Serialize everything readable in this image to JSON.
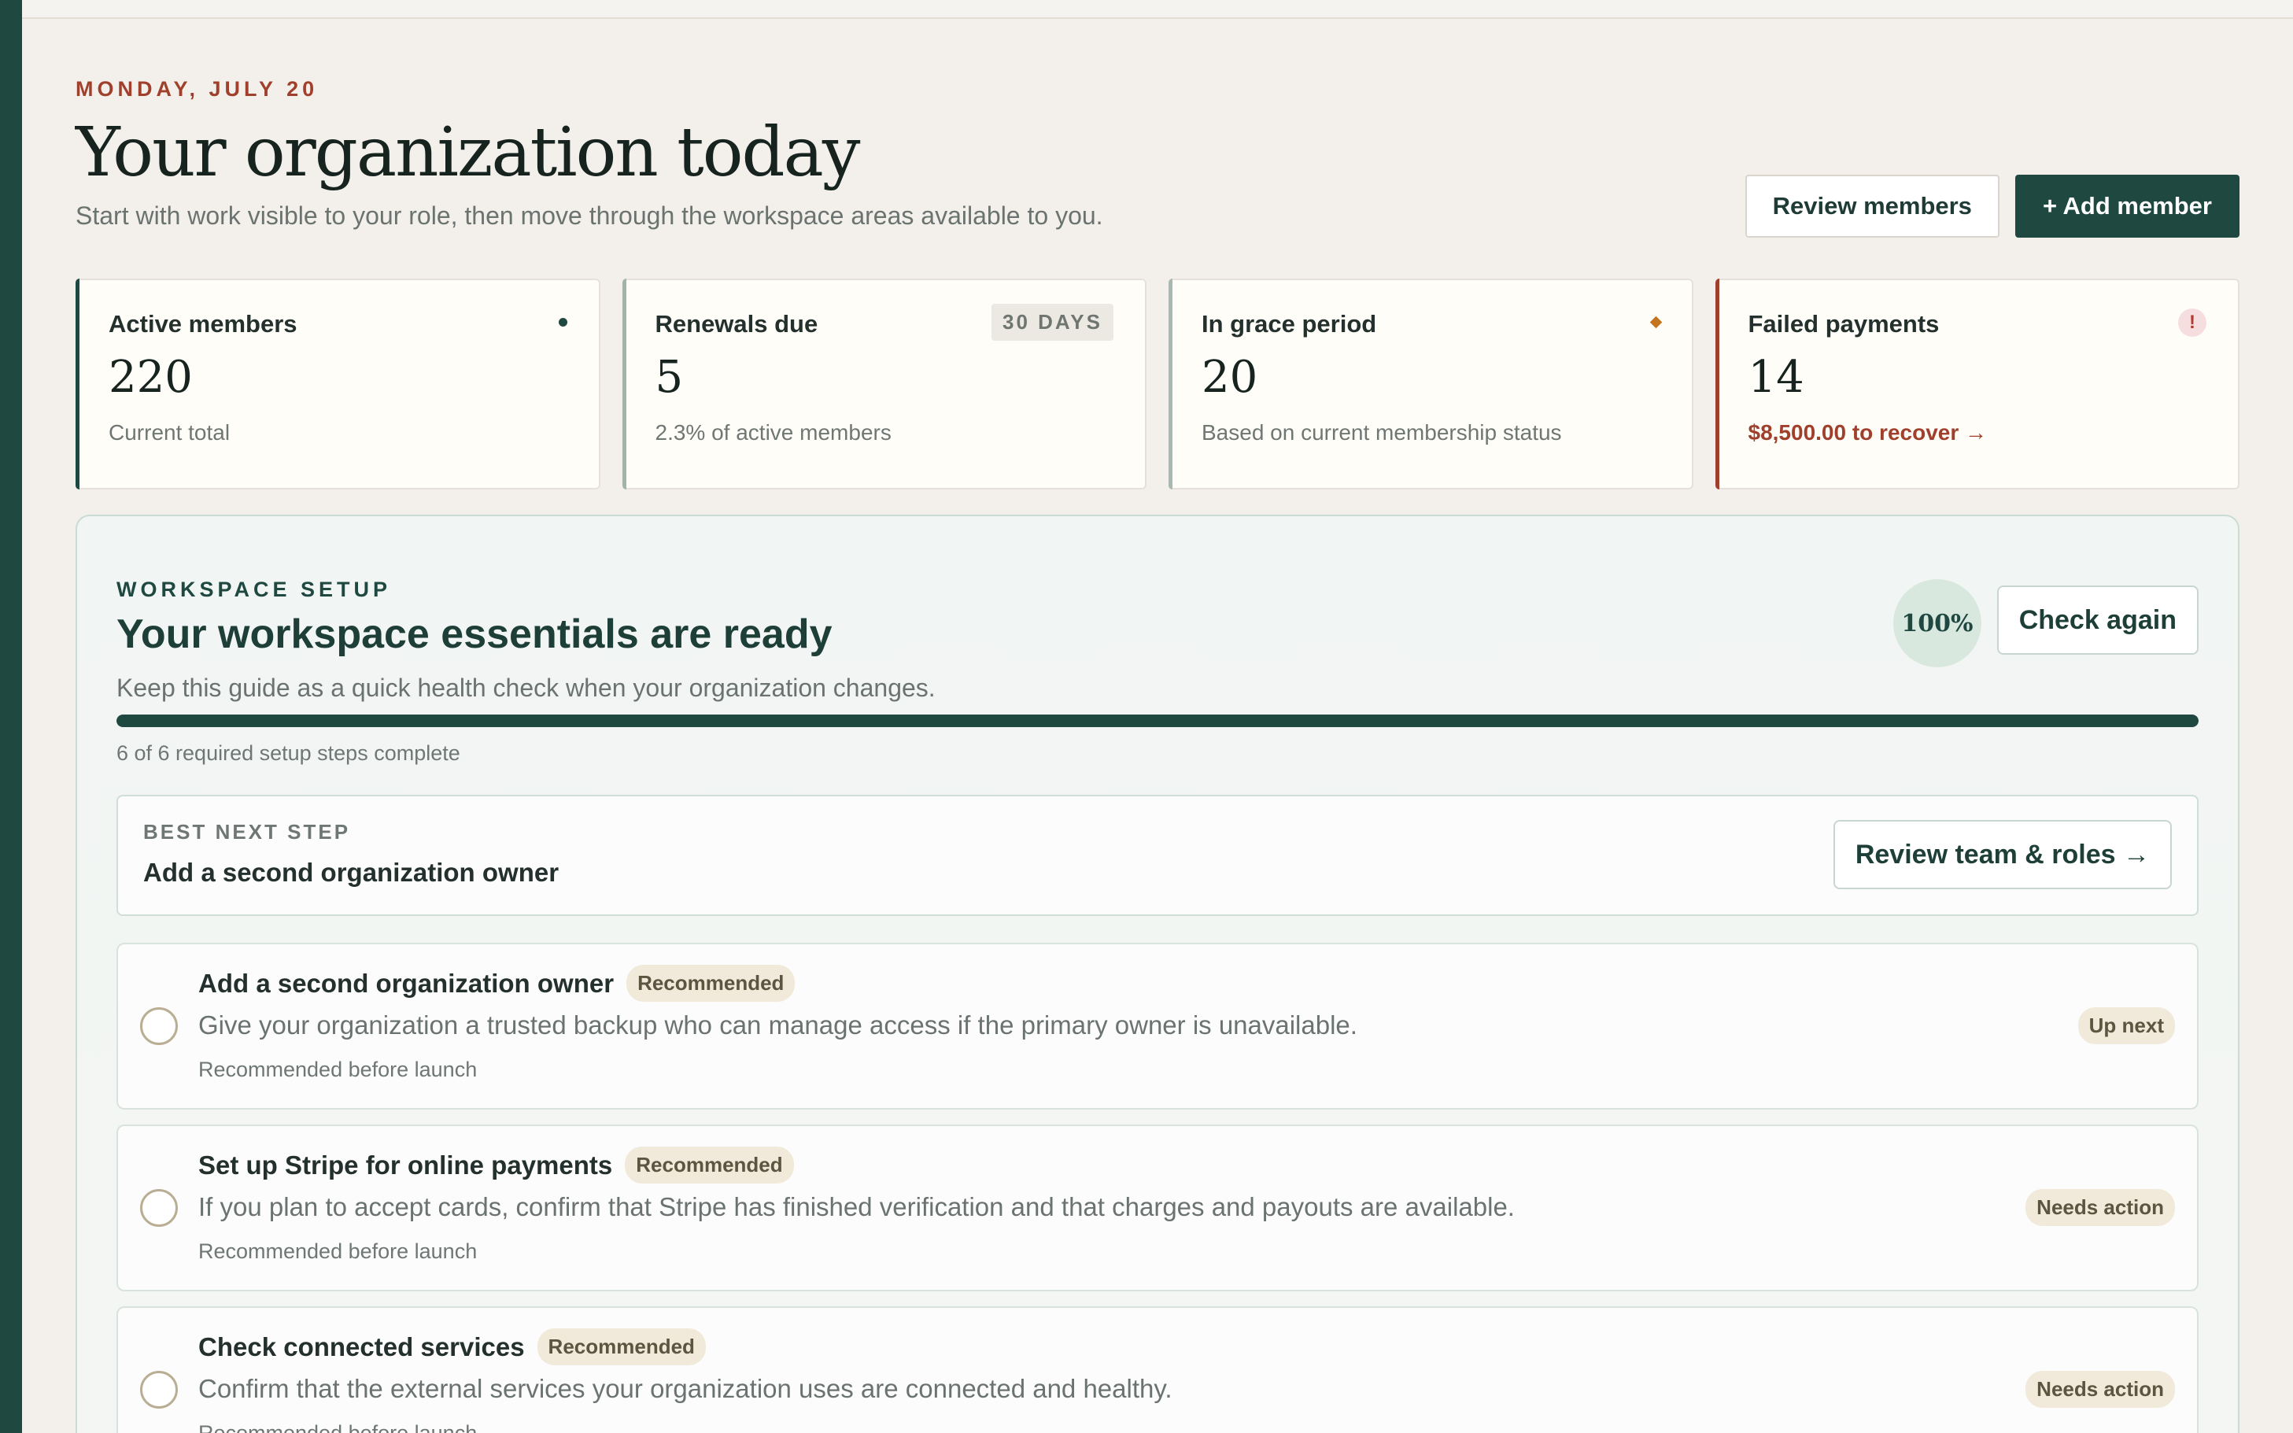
{
  "header": {
    "date": "MONDAY, JULY 20",
    "title": "Your organization today",
    "subtitle": "Start with work visible to your role, then move through the workspace areas available to you.",
    "review_members_label": "Review members",
    "add_member_label": "+  Add member"
  },
  "stats": [
    {
      "label": "Active members",
      "value": "220",
      "note": "Current total",
      "indicator": "dot-icon"
    },
    {
      "label": "Renewals due",
      "value": "5",
      "note": "2.3% of active members",
      "badge": "30 DAYS"
    },
    {
      "label": "In grace period",
      "value": "20",
      "note": "Based on current membership status",
      "indicator": "diamond-icon"
    },
    {
      "label": "Failed payments",
      "value": "14",
      "note": "$8,500.00 to recover →",
      "indicator": "exclamation-icon",
      "indicator_glyph": "!"
    }
  ],
  "setup": {
    "eyebrow": "WORKSPACE SETUP",
    "title": "Your workspace essentials are ready",
    "subtitle": "Keep this guide as a quick health check when your organization changes.",
    "percent": "100%",
    "progress_fraction": 1.0,
    "check_again_label": "Check again",
    "progress_text": "6 of 6 required setup steps complete",
    "next_step": {
      "eyebrow": "BEST NEXT STEP",
      "title": "Add a second organization owner",
      "button_label": "Review team & roles →"
    },
    "tasks": [
      {
        "title": "Add a second organization owner",
        "tag": "Recommended",
        "description": "Give your organization a trusted backup who can manage access if the primary owner is unavailable.",
        "note": "Recommended before launch",
        "status": "Up next"
      },
      {
        "title": "Set up Stripe for online payments",
        "tag": "Recommended",
        "description": "If you plan to accept cards, confirm that Stripe has finished verification and that charges and payouts are available.",
        "note": "Recommended before launch",
        "status": "Needs action"
      },
      {
        "title": "Check connected services",
        "tag": "Recommended",
        "description": "Confirm that the external services your organization uses are connected and healthy.",
        "note": "Recommended before launch",
        "status": "Needs action"
      }
    ]
  },
  "colors": {
    "brand": "#1e4840",
    "alert": "#a0402c",
    "warning": "#c4741f",
    "background": "#f3f0eb"
  }
}
